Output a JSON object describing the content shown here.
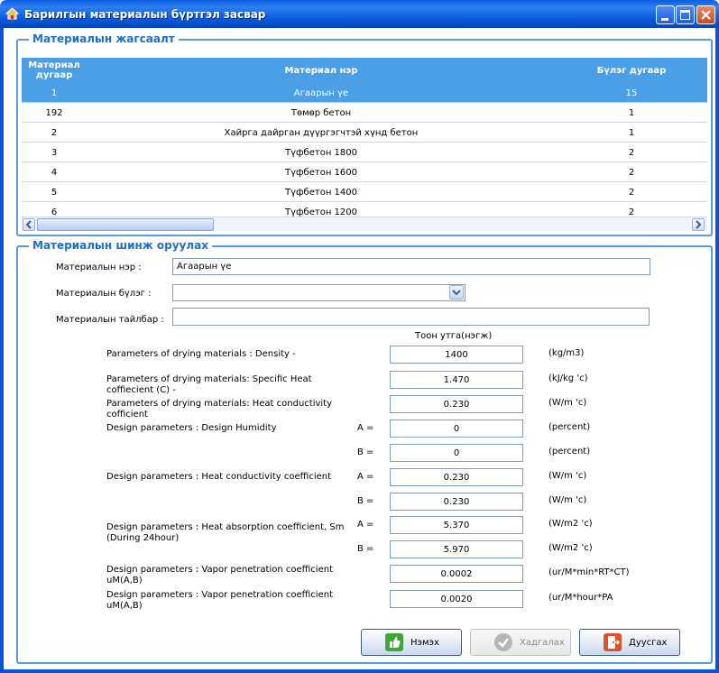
{
  "window": {
    "title": "Барилгын материалын бүртгэл засвар"
  },
  "list_group": {
    "legend": "Материалын жагсаалт"
  },
  "grid": {
    "columns": [
      "Материал дугаар",
      "Материал нэр",
      "Бүлэг дугаар"
    ],
    "rows": [
      [
        "1",
        "Агаарын үе",
        "15"
      ],
      [
        "192",
        "Төмөр бетон",
        "1"
      ],
      [
        "2",
        "Хайрга дайрган дүүргэгчтэй хүнд бетон",
        "1"
      ],
      [
        "3",
        "Түфбетон 1800",
        "2"
      ],
      [
        "4",
        "Түфбетон 1600",
        "2"
      ],
      [
        "5",
        "Түфбетон 1400",
        "2"
      ],
      [
        "6",
        "Түфбетон 1200",
        "2"
      ]
    ],
    "selected_index": 0
  },
  "props_group": {
    "legend": "Материалын шинж оруулах"
  },
  "form": {
    "name_label": "Материалын нэр :",
    "name_value": "Агаарын үе",
    "group_label": "Материалын бүлэг :",
    "group_value": "",
    "desc_label": "Материалын тайлбар :",
    "desc_value": ""
  },
  "values_header": "Тоон утга(нэгж)",
  "params": [
    {
      "label": "Parameters of drying materials : Density -",
      "sub": "",
      "value": "1400",
      "unit": "(kg/m3)"
    },
    {
      "label": "Parameters of drying materials: Specific Heat coffiecient (C) -",
      "sub": "",
      "value": "1.470",
      "unit": "(kJ/kg 'c)"
    },
    {
      "label": "Parameters of drying materials: Heat conductivity cofficient",
      "sub": "",
      "value": "0.230",
      "unit": "(W/m 'c)"
    },
    {
      "label": "Design parameters : Design Humidity",
      "sub": "A =",
      "value": "0",
      "unit": "(percent)"
    },
    {
      "label": "",
      "sub": "B =",
      "value": "0",
      "unit": "(percent)"
    },
    {
      "label": "Design parameters : Heat conductivity coefficient",
      "sub": "A =",
      "value": "0.230",
      "unit": "(W/m 'c)"
    },
    {
      "label": "",
      "sub": "B =",
      "value": "0.230",
      "unit": "(W/m 'c)"
    },
    {
      "label": "Design parameters : Heat absorption coefficient, Sm (During 24hour)",
      "sub": "A =",
      "value": "5.370",
      "unit": "(W/m2 'c)"
    },
    {
      "label": "",
      "sub": "B =",
      "value": "5.970",
      "unit": "(W/m2 'c)"
    },
    {
      "label": "Design parameters : Vapor penetration coefficient uM(A,B)",
      "sub": "",
      "value": "0.0002",
      "unit": "(ur/M*min*RT*CT)"
    },
    {
      "label": "Design parameters : Vapor penetration coefficient uM(A,B)",
      "sub": "",
      "value": "0.0020",
      "unit": "(ur/M*hour*PA"
    }
  ],
  "buttons": {
    "add": "Нэмэх",
    "save": "Хадгалах",
    "close": "Дуусгах"
  },
  "colors": {
    "accent": "#4a9fe6",
    "titlebar": "#0a5fe0",
    "legend": "#1b6fd2"
  }
}
